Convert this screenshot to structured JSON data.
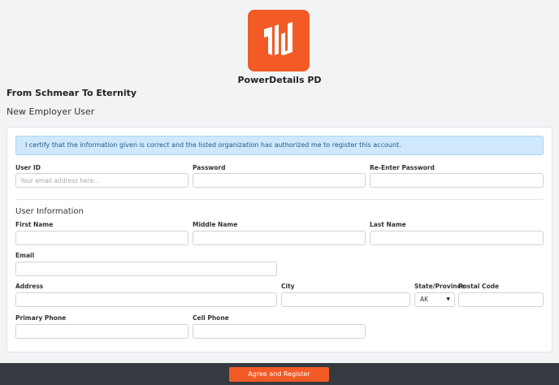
{
  "brand": {
    "name": "PowerDetails PD",
    "logo_color": "#f25a26"
  },
  "org_name": "From Schmear To Eternity",
  "page_subtitle": "New Employer User",
  "notice": "I certify that the information given is correct and the listed organization has authorized me to register this account.",
  "credentials": {
    "user_id_label": "User ID",
    "user_id_placeholder": "Your email address here...",
    "password_label": "Password",
    "reenter_label": "Re-Enter Password"
  },
  "user_info": {
    "section_title": "User Information",
    "first_name_label": "First Name",
    "middle_name_label": "Middle Name",
    "last_name_label": "Last Name",
    "email_label": "Email",
    "address_label": "Address",
    "city_label": "City",
    "state_label": "State/Province",
    "state_value": "AK",
    "postal_label": "Postal Code",
    "primary_phone_label": "Primary Phone",
    "cell_phone_label": "Cell Phone"
  },
  "submit_label": "Agree and Register",
  "colors": {
    "accent": "#f25a26",
    "footer": "#343a40",
    "notice_bg": "#cfe8fb"
  }
}
